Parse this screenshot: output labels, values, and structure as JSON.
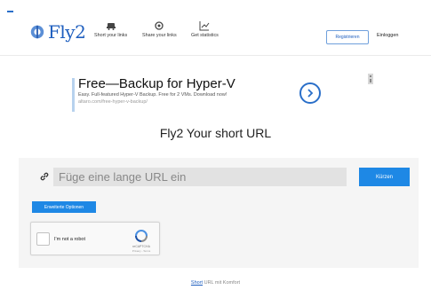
{
  "header": {
    "logo_text": "Fly2",
    "nav": [
      {
        "label": "Short your links",
        "icon": "car-icon"
      },
      {
        "label": "Share your links",
        "icon": "share-icon"
      },
      {
        "label": "Get statistics",
        "icon": "chart-icon"
      }
    ],
    "register_label": "Registrieren",
    "login_label": "Einloggen"
  },
  "ad": {
    "title": "Free—Backup for Hyper-V",
    "subtitle": "Easy. Full-featured Hyper-V Backup. Free for 2 VMs. Download now!",
    "url": "altaro.com/free-hyper-v-backup/"
  },
  "page_title": "Fly2 Your short URL",
  "form": {
    "input_placeholder": "Füge eine lange URL ein",
    "submit_label": "Kürzen",
    "options_label": "Erweiterte Optionen"
  },
  "captcha": {
    "label": "I'm not a robot",
    "brand": "reCAPTCHA",
    "terms": "Privacy - Terms"
  },
  "footer": {
    "short": "Short",
    "rest": " URL mit Komfort"
  },
  "colors": {
    "brand": "#1f5fbf",
    "button": "#1e88e5"
  }
}
